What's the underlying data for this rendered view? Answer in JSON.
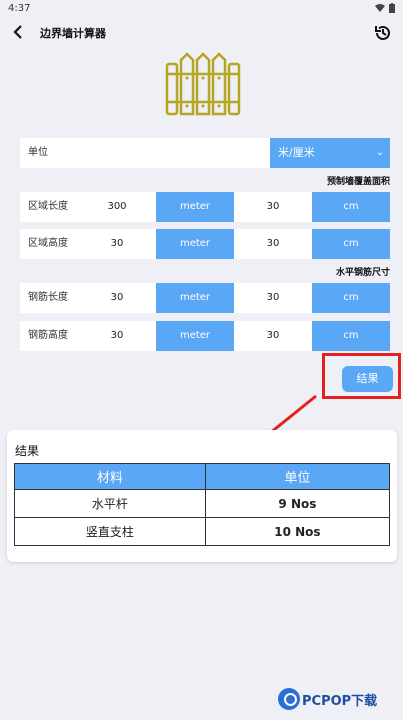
{
  "status": {
    "time": "4:37"
  },
  "header": {
    "title": "边界墙计算器"
  },
  "unit_row": {
    "label": "单位",
    "selected": "米/厘米"
  },
  "section1": {
    "title": "预制墙覆盖面积"
  },
  "area_length": {
    "label": "区域长度",
    "value1": "300",
    "unit1": "meter",
    "value2": "30",
    "unit2": "cm"
  },
  "area_height": {
    "label": "区域高度",
    "value1": "30",
    "unit1": "meter",
    "value2": "30",
    "unit2": "cm"
  },
  "section2": {
    "title": "水平钢筋尺寸"
  },
  "bar_length": {
    "label": "钢筋长度",
    "value1": "30",
    "unit1": "meter",
    "value2": "30",
    "unit2": "cm"
  },
  "bar_height": {
    "label": "钢筋高度",
    "value1": "30",
    "unit1": "meter",
    "value2": "30",
    "unit2": "cm"
  },
  "result_button": {
    "label": "结果"
  },
  "result": {
    "title": "结果",
    "columns": [
      "材料",
      "单位"
    ],
    "rows": [
      {
        "material": "水平杆",
        "unit": "9 Nos"
      },
      {
        "material": "竖直支柱",
        "unit": "10 Nos"
      }
    ]
  },
  "watermark": {
    "text": "PCPOP下载"
  },
  "colors": {
    "accent": "#5aa7f6",
    "highlight": "#e42020"
  }
}
